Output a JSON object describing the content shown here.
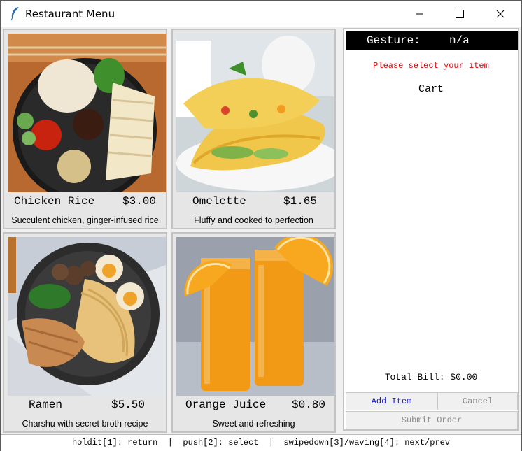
{
  "window": {
    "title": "Restaurant Menu"
  },
  "menu": {
    "items": [
      {
        "name": "Chicken Rice",
        "price": "$3.00",
        "desc": "Succulent chicken, ginger-infused rice"
      },
      {
        "name": "Omelette",
        "price": "$1.65",
        "desc": "Fluffy and cooked to perfection"
      },
      {
        "name": "Ramen",
        "price": "$5.50",
        "desc": "Charshu with secret broth recipe"
      },
      {
        "name": "Orange Juice",
        "price": "$0.80",
        "desc": "Sweet and refreshing"
      }
    ]
  },
  "panel": {
    "gesture_label": "Gesture:",
    "gesture_value": "n/a",
    "message": "Please select your item",
    "cart_title": "Cart",
    "total": "Total Bill: $0.00",
    "add_label": "Add Item",
    "cancel_label": "Cancel",
    "submit_label": "Submit Order"
  },
  "status": {
    "text": "holdit[1]: return  |  push[2]: select  |  swipedown[3]/waving[4]: next/prev"
  },
  "colors": {
    "message": "#e00000",
    "add_text": "#1a1adc",
    "disabled_text": "#8a8a8a",
    "gesture_bg": "#000000"
  }
}
